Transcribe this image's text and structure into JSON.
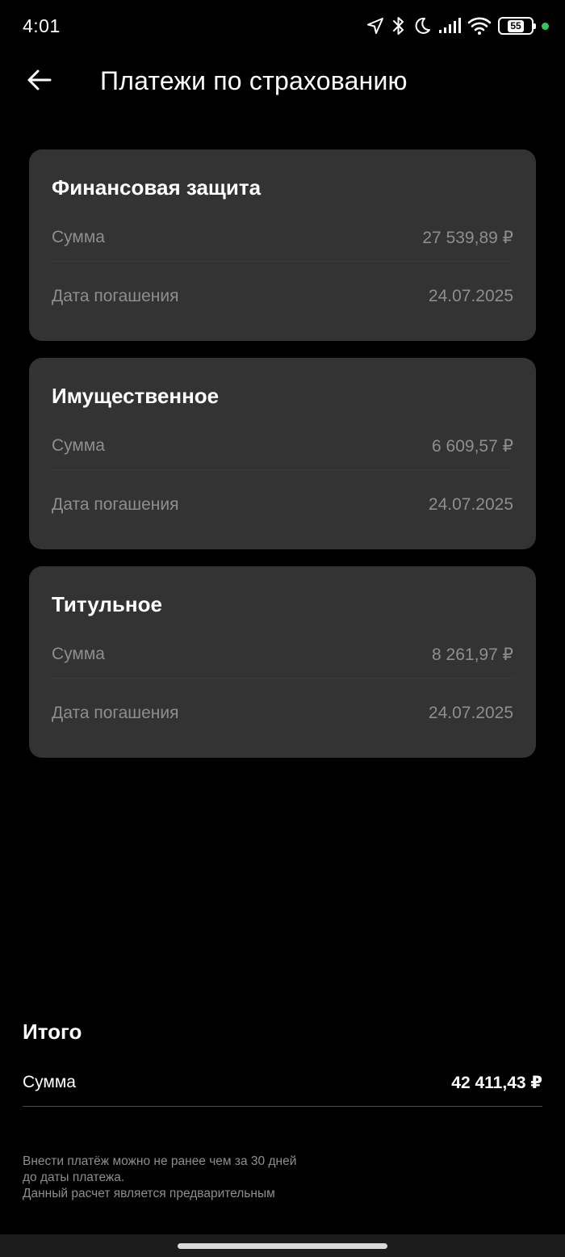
{
  "status_bar": {
    "time": "4:01",
    "battery": "55",
    "icons": [
      "location-icon",
      "bluetooth-icon",
      "moon-icon",
      "signal-icon",
      "wifi-icon",
      "battery-icon"
    ],
    "dot_color": "#34c759"
  },
  "header": {
    "title": "Платежи по страхованию",
    "back_icon": "arrow-left-icon"
  },
  "cards": [
    {
      "title": "Финансовая защита",
      "amount_label": "Сумма",
      "amount": "27 539,89 ₽",
      "date_label": "Дата погашения",
      "date": "24.07.2025"
    },
    {
      "title": "Имущественное",
      "amount_label": "Сумма",
      "amount": "6 609,57 ₽",
      "date_label": "Дата погашения",
      "date": "24.07.2025"
    },
    {
      "title": "Титульное",
      "amount_label": "Сумма",
      "amount": "8 261,97 ₽",
      "date_label": "Дата погашения",
      "date": "24.07.2025"
    }
  ],
  "total": {
    "title": "Итого",
    "label": "Сумма",
    "value": "42 411,43 ₽"
  },
  "note": {
    "line1": "Внести платёж можно не ранее чем за 30 дней",
    "line2": "до даты платежа.",
    "line3": "Данный расчет является предварительным"
  },
  "colors": {
    "background": "#000000",
    "card": "#333333",
    "muted_text": "#8e8e8e",
    "text": "#ffffff"
  }
}
